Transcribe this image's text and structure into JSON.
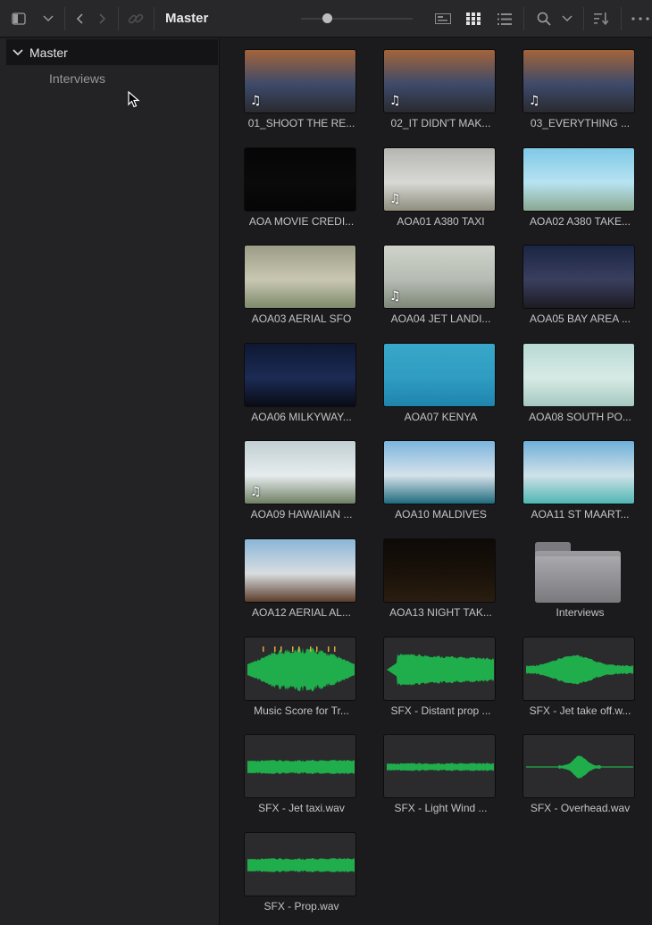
{
  "toolbar": {
    "title": "Master",
    "icons": [
      "sidebar-toggle-icon",
      "chevron-down-icon",
      "back-arrow-icon",
      "forward-arrow-icon",
      "link-icon",
      "zoom-slider",
      "metadata-view-icon",
      "thumbnail-view-icon",
      "list-view-icon",
      "search-icon",
      "chevron-down-icon",
      "sort-icon",
      "more-options-icon"
    ]
  },
  "sidebar": {
    "bins": [
      {
        "label": "Master",
        "expanded": true,
        "selected": true
      },
      {
        "label": "Interviews",
        "expanded": false,
        "selected": false
      }
    ]
  },
  "clips": [
    {
      "name": "01_SHOOT THE RE...",
      "kind": "video",
      "audio": true,
      "colors": [
        "#a3643a",
        "#3d4a6a",
        "#2a2a30"
      ]
    },
    {
      "name": "02_IT DIDN'T MAK...",
      "kind": "video",
      "audio": true,
      "colors": [
        "#a3643a",
        "#3d4a6a",
        "#2a2a30"
      ]
    },
    {
      "name": "03_EVERYTHING ...",
      "kind": "video",
      "audio": true,
      "colors": [
        "#a3643a",
        "#3d4a6a",
        "#2a2a30"
      ]
    },
    {
      "name": "AOA MOVIE CREDI...",
      "kind": "video",
      "audio": false,
      "colors": [
        "#050505",
        "#0a0a0a",
        "#050505"
      ]
    },
    {
      "name": "AOA01 A380 TAXI",
      "kind": "video",
      "audio": true,
      "colors": [
        "#b5b5b2",
        "#d8d8d4",
        "#8e8d7f"
      ]
    },
    {
      "name": "AOA02 A380 TAKE...",
      "kind": "video",
      "audio": false,
      "colors": [
        "#7fc9e6",
        "#b7e3f1",
        "#8aa890"
      ]
    },
    {
      "name": "AOA03 AERIAL SFO",
      "kind": "video",
      "audio": false,
      "colors": [
        "#9c9d86",
        "#c9c7b3",
        "#7d8a6a"
      ]
    },
    {
      "name": "AOA04 JET LANDI...",
      "kind": "video",
      "audio": true,
      "colors": [
        "#cfd3cb",
        "#b6bcb3",
        "#7e8678"
      ]
    },
    {
      "name": "AOA05 BAY AREA ...",
      "kind": "video",
      "audio": false,
      "colors": [
        "#1a2544",
        "#3a3f5e",
        "#1d1a22"
      ]
    },
    {
      "name": "AOA06 MILKYWAY...",
      "kind": "video",
      "audio": false,
      "colors": [
        "#0e1833",
        "#1c2b55",
        "#090b14"
      ]
    },
    {
      "name": "AOA07 KENYA",
      "kind": "video",
      "audio": false,
      "colors": [
        "#38a7c8",
        "#2f9cc2",
        "#1f84ad"
      ]
    },
    {
      "name": "AOA08 SOUTH PO...",
      "kind": "video",
      "audio": false,
      "colors": [
        "#b9dad5",
        "#d7eae5",
        "#a6c8c1"
      ]
    },
    {
      "name": "AOA09 HAWAIIAN ...",
      "kind": "video",
      "audio": true,
      "colors": [
        "#c1cfd3",
        "#e7ecee",
        "#6f8065"
      ]
    },
    {
      "name": "AOA10 MALDIVES",
      "kind": "video",
      "audio": false,
      "colors": [
        "#7cb5dd",
        "#d6e2ea",
        "#1f6b7d"
      ]
    },
    {
      "name": "AOA11 ST MAART...",
      "kind": "video",
      "audio": false,
      "colors": [
        "#6fb0d9",
        "#cfe1e8",
        "#4fb6b3"
      ]
    },
    {
      "name": "AOA12 AERIAL AL...",
      "kind": "video",
      "audio": false,
      "colors": [
        "#8ab6d8",
        "#d9dde0",
        "#5b3d2b"
      ]
    },
    {
      "name": "AOA13 NIGHT TAK...",
      "kind": "video",
      "audio": false,
      "colors": [
        "#0d0a07",
        "#1a120a",
        "#2a1d10"
      ]
    },
    {
      "name": "Interviews",
      "kind": "folder"
    },
    {
      "name": "Music Score for Tr...",
      "kind": "audio",
      "wave": "music"
    },
    {
      "name": "SFX - Distant prop ...",
      "kind": "audio",
      "wave": "wedge"
    },
    {
      "name": "SFX - Jet take off.w...",
      "kind": "audio",
      "wave": "diamond"
    },
    {
      "name": "SFX - Jet taxi.wav",
      "kind": "audio",
      "wave": "band"
    },
    {
      "name": "SFX - Light Wind ...",
      "kind": "audio",
      "wave": "thin"
    },
    {
      "name": "SFX - Overhead.wav",
      "kind": "audio",
      "wave": "spike"
    },
    {
      "name": "SFX - Prop.wav",
      "kind": "audio",
      "wave": "band"
    }
  ],
  "colors": {
    "waveform": "#1fae4b",
    "waveform_peak": "#d9a93a"
  }
}
